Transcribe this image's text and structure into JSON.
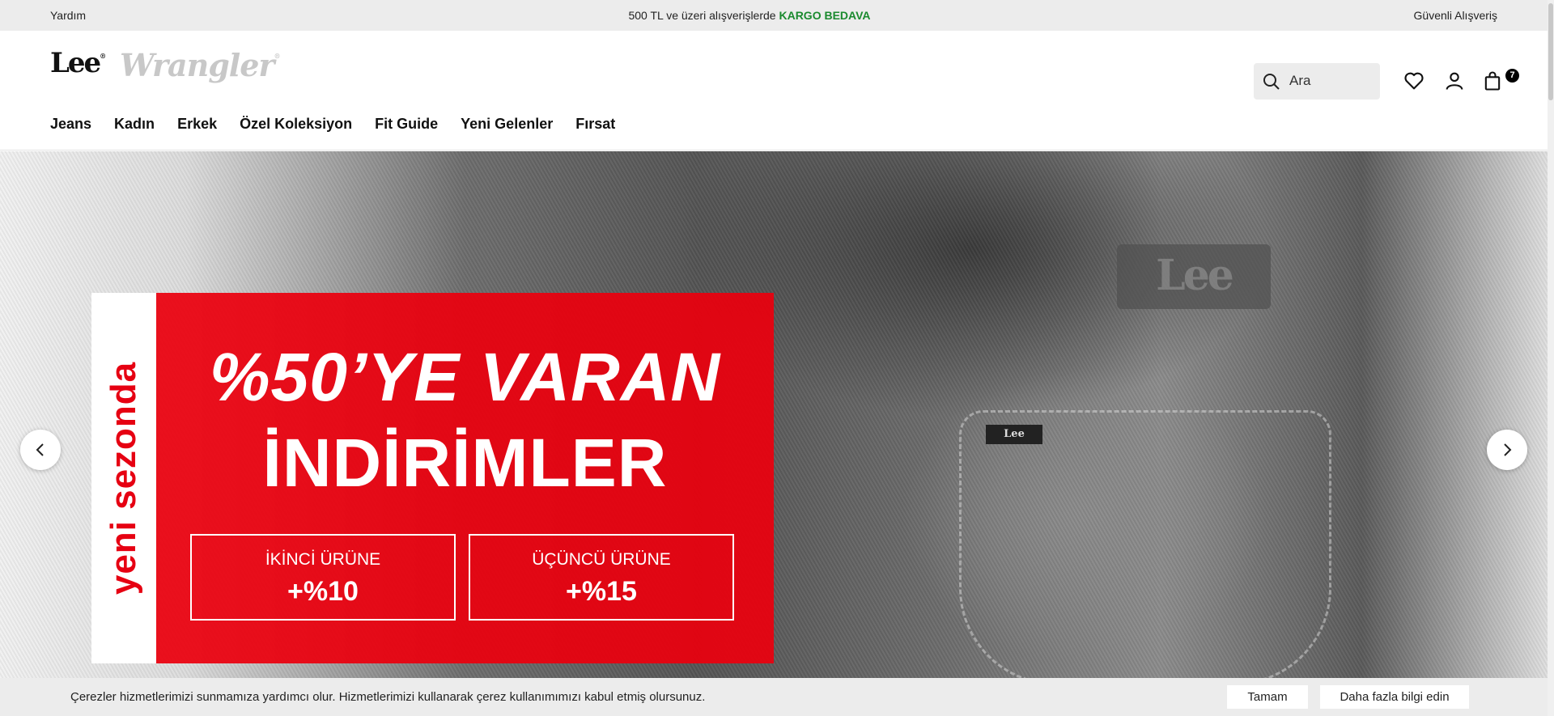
{
  "topbar": {
    "help": "Yardım",
    "promo_text": "500 TL ve üzeri alışverişlerde ",
    "promo_highlight": "KARGO BEDAVA",
    "secure": "Güvenli Alışveriş"
  },
  "header": {
    "brand_primary": "Lee",
    "brand_secondary": "Wrangler",
    "search_placeholder": "Ara",
    "cart_count": "7"
  },
  "nav": {
    "items": [
      "Jeans",
      "Kadın",
      "Erkek",
      "Özel Koleksiyon",
      "Fit Guide",
      "Yeni Gelenler",
      "Fırsat"
    ]
  },
  "hero": {
    "vertical_text": "yeni sezonda",
    "title_line1": "%50’YE VARAN",
    "title_line2": "İNDİRİMLER",
    "patch_text": "Lee",
    "tag_text": "Lee",
    "offers": [
      {
        "label": "İKİNCİ ÜRÜNE",
        "value": "+%10"
      },
      {
        "label": "ÜÇÜNCÜ ÜRÜNE",
        "value": "+%15"
      }
    ]
  },
  "cookie": {
    "text": "Çerezler hizmetlerimizi sunmamıza yardımcı olur. Hizmetlerimizi kullanarak çerez kullanımımızı kabul etmiş olursunuz.",
    "accept": "Tamam",
    "more": "Daha fazla bilgi edin"
  },
  "colors": {
    "accent_red": "#e60012",
    "promo_green": "#1a8a2e"
  },
  "icons": [
    "search-icon",
    "heart-icon",
    "user-icon",
    "shopping-bag-icon",
    "chevron-left-icon",
    "chevron-right-icon"
  ]
}
